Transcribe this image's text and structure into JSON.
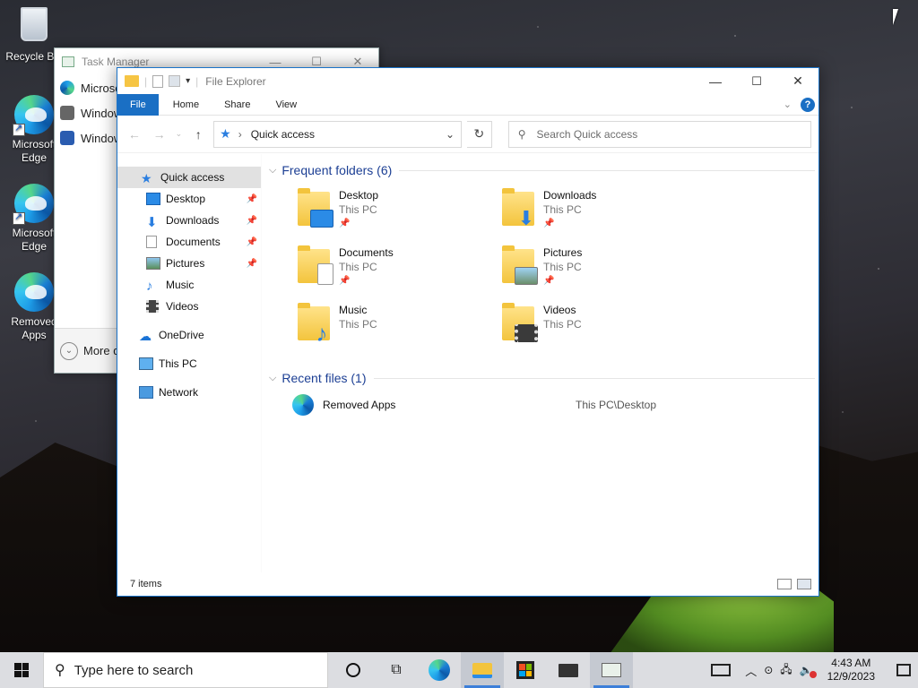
{
  "desktop": {
    "icons": [
      {
        "label": "Recycle Bin",
        "icon": "recycle-bin-icon"
      },
      {
        "label": "Microsoft Edge",
        "icon": "edge-icon"
      },
      {
        "label": "Microsoft Edge",
        "icon": "edge-icon"
      },
      {
        "label": "Removed Apps",
        "icon": "edge-icon"
      }
    ]
  },
  "task_manager": {
    "title": "Task Manager",
    "rows": [
      "Microsoft Edge",
      "Windows Explorer",
      "Windows PowerShell"
    ],
    "more_details": "More details"
  },
  "explorer": {
    "title": "File Explorer",
    "ribbon": {
      "file": "File",
      "home": "Home",
      "share": "Share",
      "view": "View"
    },
    "address": {
      "location": "Quick access"
    },
    "search": {
      "placeholder": "Search Quick access"
    },
    "nav": [
      {
        "label": "Quick access",
        "icon": "star-icon",
        "pinned": false
      },
      {
        "label": "Desktop",
        "icon": "desktop-icon",
        "pinned": true
      },
      {
        "label": "Downloads",
        "icon": "download-icon",
        "pinned": true
      },
      {
        "label": "Documents",
        "icon": "document-icon",
        "pinned": true
      },
      {
        "label": "Pictures",
        "icon": "picture-icon",
        "pinned": true
      },
      {
        "label": "Music",
        "icon": "music-icon",
        "pinned": false
      },
      {
        "label": "Videos",
        "icon": "video-icon",
        "pinned": false
      },
      {
        "label": "OneDrive",
        "icon": "cloud-icon",
        "pinned": false
      },
      {
        "label": "This PC",
        "icon": "computer-icon",
        "pinned": false
      },
      {
        "label": "Network",
        "icon": "network-icon",
        "pinned": false
      }
    ],
    "frequent_header": "Frequent folders (6)",
    "folders": [
      {
        "name": "Desktop",
        "location": "This PC",
        "pinned": true
      },
      {
        "name": "Downloads",
        "location": "This PC",
        "pinned": true
      },
      {
        "name": "Documents",
        "location": "This PC",
        "pinned": true
      },
      {
        "name": "Pictures",
        "location": "This PC",
        "pinned": true
      },
      {
        "name": "Music",
        "location": "This PC",
        "pinned": false
      },
      {
        "name": "Videos",
        "location": "This PC",
        "pinned": false
      }
    ],
    "recent_header": "Recent files (1)",
    "recent": [
      {
        "name": "Removed Apps",
        "location": "This PC\\Desktop"
      }
    ],
    "status": "7 items"
  },
  "taskbar": {
    "search_placeholder": "Type here to search",
    "time": "4:43 AM",
    "date": "12/9/2023"
  },
  "colors": {
    "accent": "#1a6fc4",
    "folder": "#f3c43d"
  }
}
